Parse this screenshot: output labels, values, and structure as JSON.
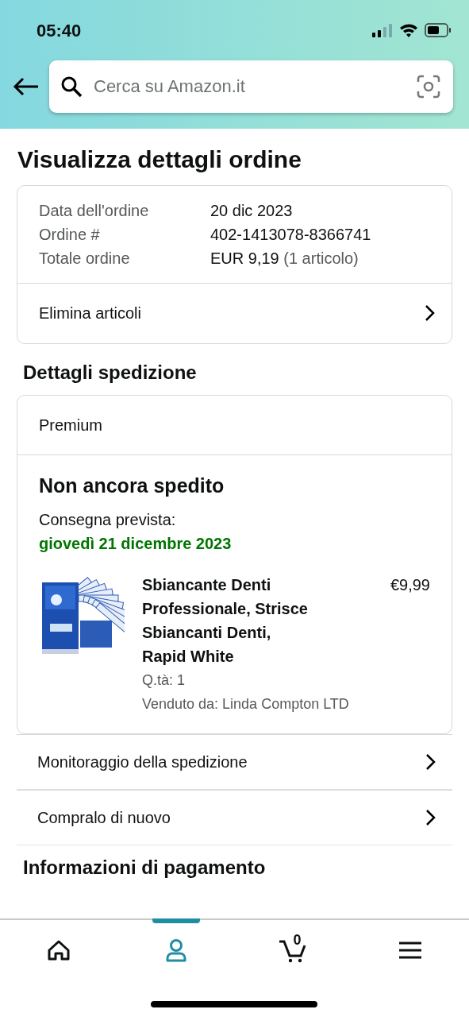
{
  "status_bar": {
    "time": "05:40"
  },
  "search": {
    "placeholder": "Cerca su Amazon.it"
  },
  "page_title": "Visualizza dettagli ordine",
  "order_summary": {
    "rows": [
      {
        "label": "Data dell'ordine",
        "value": "20 dic 2023"
      },
      {
        "label": "Ordine #",
        "value": "402-1413078-8366741"
      },
      {
        "label": "Totale ordine",
        "value": "EUR 9,19",
        "note": "(1 articolo)"
      }
    ],
    "action": "Elimina articoli"
  },
  "shipping": {
    "heading": "Dettagli spedizione",
    "program": "Premium",
    "status": "Non ancora spedito",
    "delivery_label": "Consegna prevista:",
    "delivery_date": "giovedì 21 dicembre 2023",
    "item": {
      "kind": "picture",
      "title": "Sbiancante Denti Professionale, Strisce Sbiancanti Denti, Rapid White",
      "price": "€9,99",
      "quantity": "Q.tà: 1",
      "seller": "Venduto da: Linda Compton LTD"
    }
  },
  "links": [
    "Monitoraggio della spedizione",
    "Compralo di nuovo"
  ],
  "next_heading": "Informazioni di pagamento",
  "bottom_nav": [
    {
      "kind": "home",
      "selected": false
    },
    {
      "kind": "account",
      "selected": true
    },
    {
      "kind": "cart",
      "selected": false,
      "count": "0"
    },
    {
      "kind": "menu",
      "selected": false
    }
  ]
}
